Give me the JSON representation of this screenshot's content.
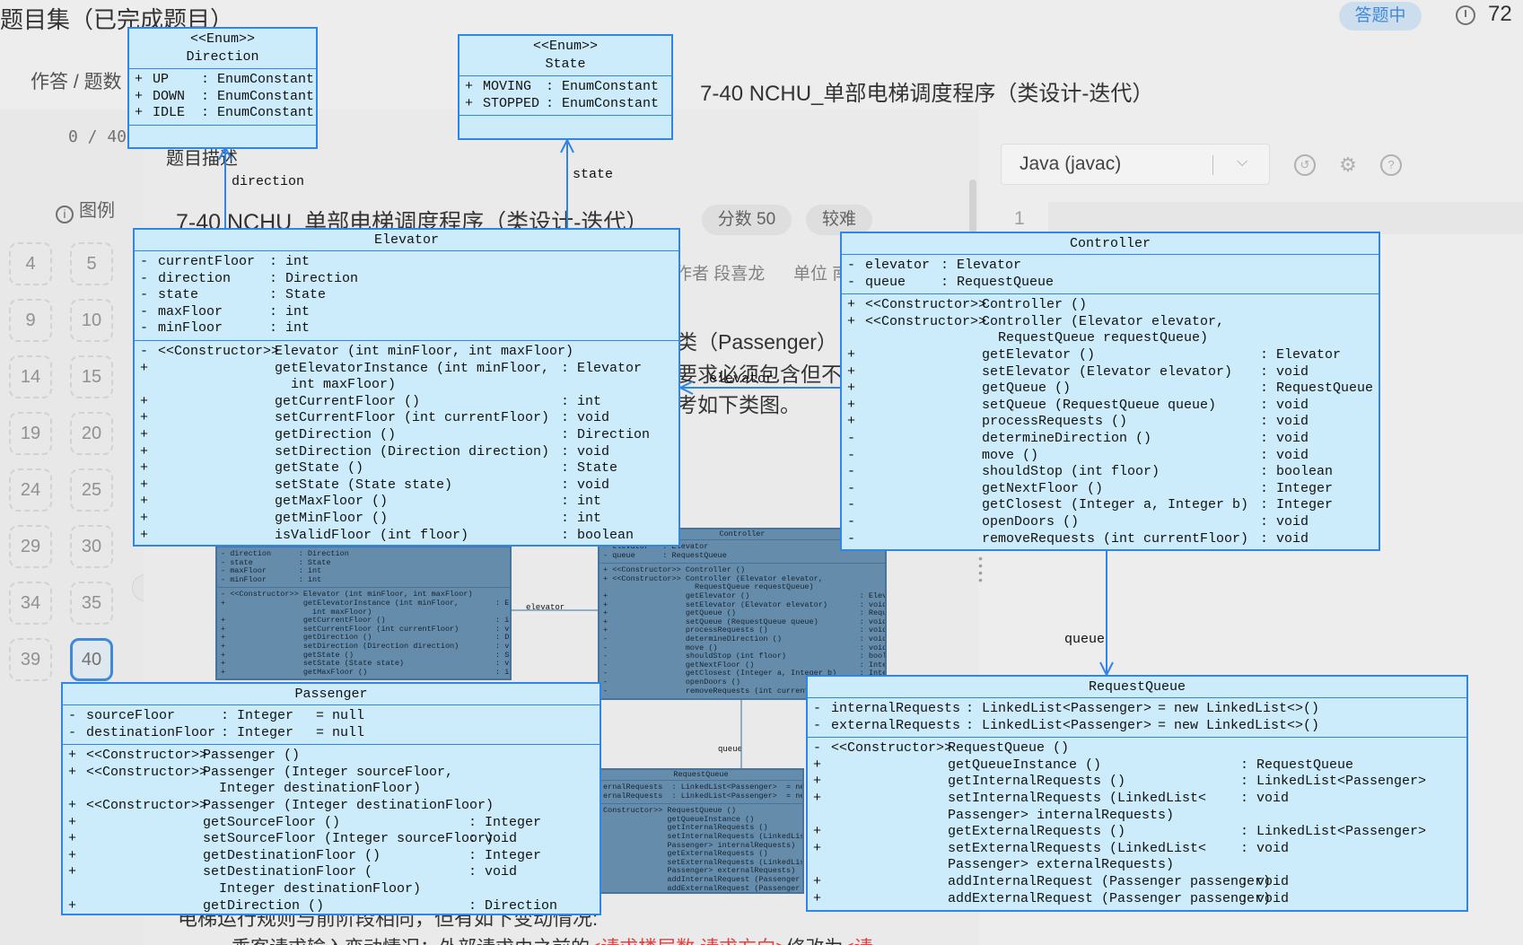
{
  "header": {
    "page_title": "题目集（已完成题目）",
    "status": "答题中",
    "timer": "72"
  },
  "sidebar": {
    "subtitle": "作答 / 题数",
    "progress": "0 / 40",
    "legend_icon": "i",
    "legend": "图例",
    "numbers": [
      "4",
      "5",
      "9",
      "10",
      "14",
      "15",
      "19",
      "20",
      "24",
      "25",
      "29",
      "30",
      "34",
      "35",
      "39",
      "40"
    ],
    "active": "40",
    "collapse": "‹"
  },
  "main": {
    "title": "7-40 NCHU_单部电梯调度程序（类设计-迭代）",
    "desc_heading": "题目描述",
    "problem_title": "7-40 NCHU_单部电梯调度程序（类设计-迭代）",
    "score": "分数 50",
    "difficulty": "较难",
    "author_label": "作者 段喜龙",
    "unit_label": "单位 南",
    "text_passenger": "类（Passenger）",
    "text_req": "要求必须包含但不",
    "text_ref": "考如下类图。",
    "bottom_text": "电梯运行规则与前阶段相同，但有如下变动情况:",
    "bottom_text2_a": "乘客请求输入变动情况：外部请求由之前的",
    "bottom_text2_red": "<请求楼层数,请求方向>",
    "bottom_text2_b": "修改为",
    "bottom_text2_red2": "<请"
  },
  "editor": {
    "language": "Java (javac)",
    "chevron": "⌵",
    "history_icon": "↺",
    "settings_icon": "⚙",
    "help_icon": "?",
    "line_number": "1"
  },
  "diagram": {
    "direction": {
      "stereotype": "<<Enum>>",
      "name": "Direction",
      "attrs": [
        [
          "+",
          "UP",
          ": EnumConstant"
        ],
        [
          "+",
          "DOWN",
          ": EnumConstant"
        ],
        [
          "+",
          "IDLE",
          ": EnumConstant"
        ]
      ]
    },
    "state": {
      "stereotype": "<<Enum>>",
      "name": "State",
      "attrs": [
        [
          "+",
          "MOVING",
          ": EnumConstant"
        ],
        [
          "+",
          "STOPPED",
          ": EnumConstant"
        ]
      ]
    },
    "elevator": {
      "name": "Elevator",
      "attrs": [
        [
          "-",
          "currentFloor",
          ": int"
        ],
        [
          "-",
          "direction",
          ": Direction"
        ],
        [
          "-",
          "state",
          ": State"
        ],
        [
          "-",
          "maxFloor",
          ": int"
        ],
        [
          "-",
          "minFloor",
          ": int"
        ]
      ],
      "ops": [
        [
          "-",
          "<<Constructor>>",
          "Elevator (int minFloor, int maxFloor)",
          ""
        ],
        [
          "+",
          "",
          "getElevatorInstance (int minFloor,",
          ": Elevator"
        ],
        [
          "",
          "",
          "  int maxFloor)",
          ""
        ],
        [
          "+",
          "",
          "getCurrentFloor ()",
          ": int"
        ],
        [
          "+",
          "",
          "setCurrentFloor (int currentFloor)",
          ": void"
        ],
        [
          "+",
          "",
          "getDirection ()",
          ": Direction"
        ],
        [
          "+",
          "",
          "setDirection (Direction direction)",
          ": void"
        ],
        [
          "+",
          "",
          "getState ()",
          ": State"
        ],
        [
          "+",
          "",
          "setState (State state)",
          ": void"
        ],
        [
          "+",
          "",
          "getMaxFloor ()",
          ": int"
        ],
        [
          "+",
          "",
          "getMinFloor ()",
          ": int"
        ],
        [
          "+",
          "",
          "isValidFloor (int floor)",
          ": boolean"
        ]
      ]
    },
    "controller": {
      "name": "Controller",
      "attrs": [
        [
          "-",
          "elevator",
          ": Elevator"
        ],
        [
          "-",
          "queue",
          ": RequestQueue"
        ]
      ],
      "ops": [
        [
          "+",
          "<<Constructor>>",
          "Controller ()",
          ""
        ],
        [
          "+",
          "<<Constructor>>",
          "Controller (Elevator elevator,",
          ""
        ],
        [
          "",
          "",
          "  RequestQueue requestQueue)",
          ""
        ],
        [
          "+",
          "",
          "getElevator ()",
          ": Elevator"
        ],
        [
          "+",
          "",
          "setElevator (Elevator elevator)",
          ": void"
        ],
        [
          "+",
          "",
          "getQueue ()",
          ": RequestQueue"
        ],
        [
          "+",
          "",
          "setQueue (RequestQueue queue)",
          ": void"
        ],
        [
          "+",
          "",
          "processRequests ()",
          ": void"
        ],
        [
          "-",
          "",
          "determineDirection ()",
          ": void"
        ],
        [
          "-",
          "",
          "move ()",
          ": void"
        ],
        [
          "-",
          "",
          "shouldStop (int floor)",
          ": boolean"
        ],
        [
          "-",
          "",
          "getNextFloor ()",
          ": Integer"
        ],
        [
          "-",
          "",
          "getClosest (Integer a, Integer b)",
          ": Integer"
        ],
        [
          "-",
          "",
          "openDoors ()",
          ": void"
        ],
        [
          "-",
          "",
          "removeRequests (int currentFloor)",
          ": void"
        ]
      ]
    },
    "passenger": {
      "name": "Passenger",
      "attrs": [
        [
          "-",
          "sourceFloor",
          ": Integer",
          "= null"
        ],
        [
          "-",
          "destinationFloor",
          ": Integer",
          "= null"
        ]
      ],
      "ops": [
        [
          "+",
          "<<Constructor>>",
          "Passenger ()",
          ""
        ],
        [
          "+",
          "<<Constructor>>",
          "Passenger (Integer sourceFloor,",
          ""
        ],
        [
          "",
          "",
          "  Integer destinationFloor)",
          ""
        ],
        [
          "+",
          "<<Constructor>>",
          "Passenger (Integer destinationFloor)",
          ""
        ],
        [
          "+",
          "",
          "getSourceFloor ()",
          ": Integer"
        ],
        [
          "+",
          "",
          "setSourceFloor (Integer sourceFloor)",
          ": void"
        ],
        [
          "+",
          "",
          "getDestinationFloor ()",
          ": Integer"
        ],
        [
          "+",
          "",
          "setDestinationFloor (",
          ": void"
        ],
        [
          "",
          "",
          "  Integer destinationFloor)",
          ""
        ],
        [
          "+",
          "",
          "getDirection ()",
          ": Direction"
        ]
      ]
    },
    "requestqueue": {
      "name": "RequestQueue",
      "attrs": [
        [
          "-",
          "internalRequests",
          ": LinkedList<Passenger>",
          "= new LinkedList<>()"
        ],
        [
          "-",
          "externalRequests",
          ": LinkedList<Passenger>",
          "= new LinkedList<>()"
        ]
      ],
      "ops": [
        [
          "-",
          "<<Constructor>>",
          "RequestQueue ()",
          ""
        ],
        [
          "+",
          "",
          "getQueueInstance ()",
          ": RequestQueue"
        ],
        [
          "+",
          "",
          "getInternalRequests ()",
          ": LinkedList<Passenger>"
        ],
        [
          "+",
          "",
          "setInternalRequests (LinkedList<",
          ": void"
        ],
        [
          "",
          "",
          "Passenger> internalRequests)",
          ""
        ],
        [
          "+",
          "",
          "getExternalRequests ()",
          ": LinkedList<Passenger>"
        ],
        [
          "+",
          "",
          "setExternalRequests (LinkedList<",
          ": void"
        ],
        [
          "",
          "",
          "Passenger> externalRequests)",
          ""
        ],
        [
          "+",
          "",
          "addInternalRequest (Passenger passenger)",
          ": void"
        ],
        [
          "+",
          "",
          "addExternalRequest (Passenger passenger)",
          ": void"
        ]
      ]
    },
    "labels": {
      "direction": "direction",
      "state": "state",
      "elevator": "elevator",
      "queue": "queue"
    },
    "background": {
      "controller_name": "Controller",
      "requestqueue_name": "RequestQueue",
      "elevator_label": "elevator",
      "queue_label": "queue",
      "elevator_attrs": [
        "- direction      : Direction",
        "- state          : State",
        "- maxFloor       : int",
        "- minFloor       : int"
      ],
      "elevator_ops": [
        "- <<Constructor>> Elevator (int minFloor, int maxFloor)",
        "+                 getElevatorInstance (int minFloor,        : Elevator",
        "                    int maxFloor)",
        "+                 getCurrentFloor ()                        : int",
        "+                 setCurrentFloor (int currentFloor)        : void",
        "+                 getDirection ()                           : Direction",
        "+                 setDirection (Direction direction)        : void",
        "+                 getState ()                               : State",
        "+                 setState (State state)                    : void",
        "+                 getMaxFloor ()                            : int"
      ],
      "controller_attrs": [
        "- elevator   : Elevator",
        "- queue      : RequestQueue"
      ],
      "controller_ops": [
        "+ <<Constructor>> Controller ()",
        "+ <<Constructor>> Controller (Elevator elevator,",
        "                    RequestQueue requestQueue)",
        "+                 getElevator ()                        : Elevator",
        "+                 setElevator (Elevator elevator)       : void",
        "+                 getQueue ()                           : RequestQueue",
        "+                 setQueue (RequestQueue queue)         : void",
        "+                 processRequests ()                    : void",
        "-                 determineDirection ()                 : void",
        "-                 move ()                               : void",
        "-                 shouldStop (int floor)                : boolean",
        "-                 getNextFloor ()                       : Integer",
        "-                 getClosest (Integer a, Integer b)     : Integer",
        "-                 openDoors ()                          : void",
        "-                 removeRequests (int currentFloor)     : void"
      ],
      "requestqueue_attrs": [
        "ernalRequests  : LinkedList<Passenger>  = new Li",
        "ernalRequests  : LinkedList<Passenger>  = new Li"
      ],
      "requestqueue_ops": [
        "Constructor>> RequestQueue ()",
        "              getQueueInstance ()",
        "              getInternalRequests ()",
        "              setInternalRequests (LinkedList<",
        "              Passenger> internalRequests)",
        "              getExternalRequests ()",
        "              setExternalRequests (LinkedList<",
        "              Passenger> externalRequests)",
        "              addInternalRequest (Passenger passe",
        "              addExternalRequest (Passenger passe"
      ]
    }
  }
}
